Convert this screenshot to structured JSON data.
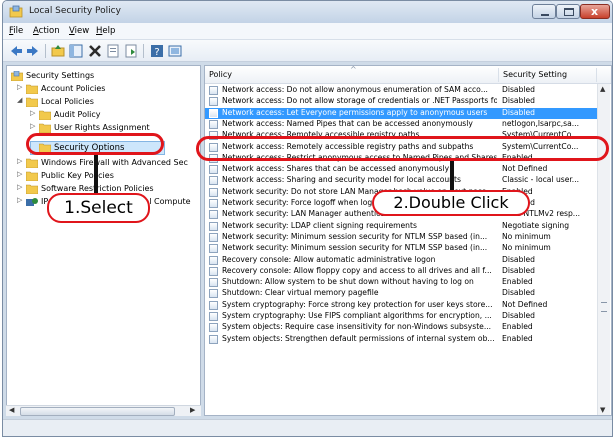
{
  "window": {
    "title": "Local Security Policy"
  },
  "menu": [
    {
      "label": "File",
      "key": "F",
      "rest": "ile"
    },
    {
      "label": "Action",
      "key": "A",
      "rest": "ction"
    },
    {
      "label": "View",
      "key": "V",
      "rest": "iew"
    },
    {
      "label": "Help",
      "key": "H",
      "rest": "elp"
    }
  ],
  "toolbar": {
    "icons": [
      "back-icon",
      "forward-icon",
      "up-folder-icon",
      "show-tree-icon",
      "delete-icon",
      "properties-icon",
      "export-icon",
      "help-icon",
      "view-icon"
    ]
  },
  "tree": {
    "items": [
      {
        "label": "Security Settings",
        "icon": "security-settings-icon",
        "arrow": ""
      },
      {
        "label": "Account Policies",
        "icon": "folder-icon",
        "arrow": "▷"
      },
      {
        "label": "Local Policies",
        "icon": "folder-icon",
        "arrow": "◢"
      },
      {
        "label": "Audit Policy",
        "icon": "folder-icon",
        "arrow": "▷"
      },
      {
        "label": "User Rights Assignment",
        "icon": "folder-icon",
        "arrow": "▷"
      },
      {
        "label": "Security Options",
        "icon": "folder-icon",
        "arrow": ""
      },
      {
        "label": "Windows Firewall with Advanced Sec",
        "icon": "folder-icon",
        "arrow": "▷"
      },
      {
        "label": "Public Key Policies",
        "icon": "folder-icon",
        "arrow": "▷"
      },
      {
        "label": "Software Restriction Policies",
        "icon": "folder-icon",
        "arrow": "▷"
      },
      {
        "label": "IP Security Policies on Local Compute",
        "icon": "ip-security-icon",
        "arrow": "▷"
      }
    ]
  },
  "list": {
    "headers": {
      "policy": "Policy",
      "setting": "Security Setting"
    },
    "rows": [
      {
        "policy": "Network access: Do not allow anonymous enumeration of SAM acco...",
        "setting": "Disabled"
      },
      {
        "policy": "Network access: Do not allow storage of credentials or .NET Passports fo...",
        "setting": "Disabled"
      },
      {
        "policy": "Network access: Let Everyone permissions apply to anonymous users",
        "setting": "Disabled",
        "selected": true
      },
      {
        "policy": "Network access: Named Pipes that can be accessed anonymously",
        "setting": "netlogon,lsarpc,sa..."
      },
      {
        "policy": "Network access: Remotely accessible registry paths",
        "setting": "System\\CurrentCo..."
      },
      {
        "policy": "Network access: Remotely accessible registry paths and subpaths",
        "setting": "System\\CurrentCo..."
      },
      {
        "policy": "Network access: Restrict anonymous access to Named Pipes and Shares",
        "setting": "Enabled"
      },
      {
        "policy": "Network access: Shares that can be accessed anonymously",
        "setting": "Not Defined"
      },
      {
        "policy": "Network access: Sharing and security model for local accounts",
        "setting": "Classic - local user..."
      },
      {
        "policy": "Network security: Do not store LAN Manager hash value on next pass...",
        "setting": "Enabled"
      },
      {
        "policy": "Network security: Force logoff when logon hours expire",
        "setting": "Disabled"
      },
      {
        "policy": "Network security: LAN Manager authentication level",
        "setting": "Send NTLMv2 resp..."
      },
      {
        "policy": "Network security: LDAP client signing requirements",
        "setting": "Negotiate signing"
      },
      {
        "policy": "Network security: Minimum session security for NTLM SSP based (in...",
        "setting": "No minimum"
      },
      {
        "policy": "Network security: Minimum session security for NTLM SSP based (in...",
        "setting": "No minimum"
      },
      {
        "policy": "Recovery console: Allow automatic administrative logon",
        "setting": "Disabled"
      },
      {
        "policy": "Recovery console: Allow floppy copy and access to all drives and all f...",
        "setting": "Disabled"
      },
      {
        "policy": "Shutdown: Allow system to be shut down without having to log on",
        "setting": "Enabled"
      },
      {
        "policy": "Shutdown: Clear virtual memory pagefile",
        "setting": "Disabled"
      },
      {
        "policy": "System cryptography: Force strong key protection for user keys store...",
        "setting": "Not Defined"
      },
      {
        "policy": "System cryptography: Use FIPS compliant algorithms for encryption, ...",
        "setting": "Disabled"
      },
      {
        "policy": "System objects: Require case insensitivity for non-Windows subsyste...",
        "setting": "Enabled"
      },
      {
        "policy": "System objects: Strengthen default permissions of internal system ob...",
        "setting": "Enabled"
      }
    ]
  },
  "annotations": {
    "select_label": "1.Select",
    "double_click_label": "2.Double Click"
  },
  "colors": {
    "selection": "#3399ff",
    "annotation_red": "#e0151b",
    "folder": "#f2c94c"
  }
}
